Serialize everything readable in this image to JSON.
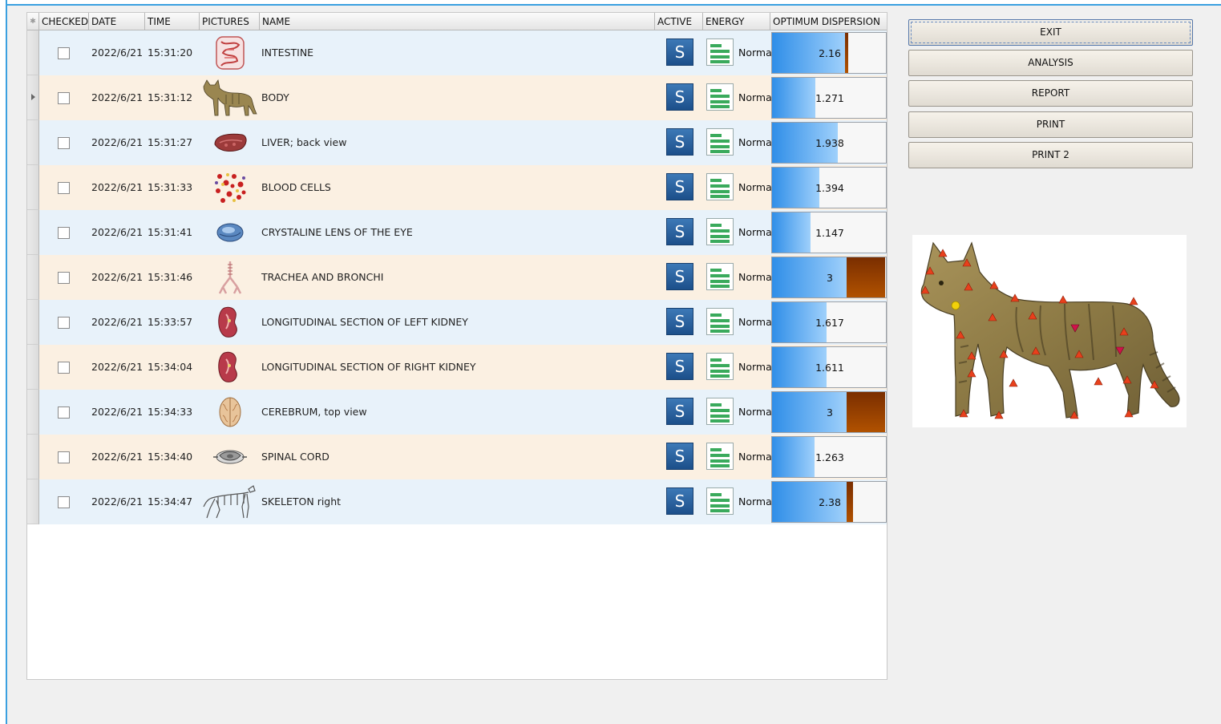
{
  "columns": [
    "CHECKED",
    "DATE",
    "TIME",
    "PICTURES",
    "NAME",
    "ACTIVE",
    "ENERGY",
    "OPTIMUM DISPERSION"
  ],
  "rows": [
    {
      "date": "2022/6/21",
      "time": "15:31:20",
      "name": "INTESTINE",
      "active": "S",
      "energy": "Norma",
      "dispersion": "2.16",
      "dispersion_value": 2.16,
      "picture_icon": "intestine-icon"
    },
    {
      "date": "2022/6/21",
      "time": "15:31:12",
      "name": "BODY",
      "active": "S",
      "energy": "Norma",
      "dispersion": "1.271",
      "dispersion_value": 1.271,
      "picture_icon": "cat-body-icon"
    },
    {
      "date": "2022/6/21",
      "time": "15:31:27",
      "name": "LIVER; back view",
      "active": "S",
      "energy": "Norma",
      "dispersion": "1.938",
      "dispersion_value": 1.938,
      "picture_icon": "liver-icon"
    },
    {
      "date": "2022/6/21",
      "time": "15:31:33",
      "name": "BLOOD  CELLS",
      "active": "S",
      "energy": "Norma",
      "dispersion": "1.394",
      "dispersion_value": 1.394,
      "picture_icon": "blood-cells-icon"
    },
    {
      "date": "2022/6/21",
      "time": "15:31:41",
      "name": "CRYSTALINE LENS OF THE EYE",
      "active": "S",
      "energy": "Norma",
      "dispersion": "1.147",
      "dispersion_value": 1.147,
      "picture_icon": "eye-lens-icon"
    },
    {
      "date": "2022/6/21",
      "time": "15:31:46",
      "name": "TRACHEA  AND  BRONCHI",
      "active": "S",
      "energy": "Norma",
      "dispersion": "3",
      "dispersion_value": 3,
      "picture_icon": "trachea-icon"
    },
    {
      "date": "2022/6/21",
      "time": "15:33:57",
      "name": "LONGITUDINAL  SECTION  OF  LEFT KIDNEY",
      "active": "S",
      "energy": "Norma",
      "dispersion": "1.617",
      "dispersion_value": 1.617,
      "picture_icon": "kidney-icon"
    },
    {
      "date": "2022/6/21",
      "time": "15:34:04",
      "name": "LONGITUDINAL  SECTION  OF  RIGHT  KIDNEY",
      "active": "S",
      "energy": "Norma",
      "dispersion": "1.611",
      "dispersion_value": 1.611,
      "picture_icon": "kidney-icon"
    },
    {
      "date": "2022/6/21",
      "time": "15:34:33",
      "name": "CEREBRUM, top view",
      "active": "S",
      "energy": "Norma",
      "dispersion": "3",
      "dispersion_value": 3,
      "picture_icon": "cerebrum-icon"
    },
    {
      "date": "2022/6/21",
      "time": "15:34:40",
      "name": "SPINAL CORD",
      "active": "S",
      "energy": "Norma",
      "dispersion": "1.263",
      "dispersion_value": 1.263,
      "picture_icon": "spinal-cord-icon"
    },
    {
      "date": "2022/6/21",
      "time": "15:34:47",
      "name": "SKELETON right",
      "active": "S",
      "energy": "Norma",
      "dispersion": "2.38",
      "dispersion_value": 2.38,
      "picture_icon": "skeleton-icon"
    }
  ],
  "current_row": 1,
  "buttons": {
    "exit": "EXIT",
    "analysis": "ANALYSIS",
    "report": "REPORT",
    "print": "PRINT",
    "print2": "PRINT 2"
  },
  "preview_image": "cat-body-map-icon",
  "colors": {
    "row_blue": "#e8f2fa",
    "row_tan": "#fbf0e2",
    "active_button": "#1c4f8a",
    "bar_blue": "#2f8ee8",
    "bar_brown": "#8a3800",
    "marker_red": "#e8401c",
    "marker_yellow": "#f2d10a"
  }
}
